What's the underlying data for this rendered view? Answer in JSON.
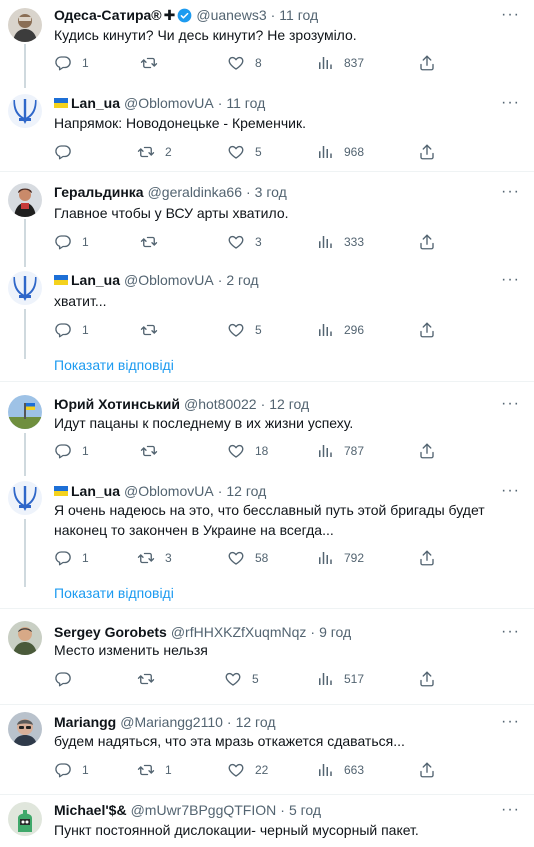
{
  "tweets": [
    {
      "name": "Одеса-Сатира®",
      "cross": "✚",
      "handle": "@uanews3",
      "time": "11 год",
      "text": "Кудись кинути? Чи десь кинути? Не зрозуміло.",
      "replies": "1",
      "retweets": "",
      "likes": "8",
      "views": "837"
    },
    {
      "name": "Lan_ua",
      "handle": "@OblomovUA",
      "time": "11 год",
      "text": "Напрямок: Новодонецьке - Кременчик.",
      "replies": "",
      "retweets": "2",
      "likes": "5",
      "views": "968"
    },
    {
      "name": "Геральдинка",
      "handle": "@geraldinka66",
      "time": "3 год",
      "text": "Главное чтобы у ВСУ арты хватило.",
      "replies": "1",
      "retweets": "",
      "likes": "3",
      "views": "333"
    },
    {
      "name": "Lan_ua",
      "handle": "@OblomovUA",
      "time": "2 год",
      "text": "хватит...",
      "replies": "1",
      "retweets": "",
      "likes": "5",
      "views": "296"
    },
    {
      "name": "Юрий Хотинський",
      "handle": "@hot80022",
      "time": "12 год",
      "text": "Идут пацаны к последнему в их жизни успеху.",
      "replies": "1",
      "retweets": "",
      "likes": "18",
      "views": "787"
    },
    {
      "name": "Lan_ua",
      "handle": "@OblomovUA",
      "time": "12 год",
      "text": "Я очень надеюсь на это, что бесславный путь этой бригады будет наконец то закончен в Украине на всегда...",
      "replies": "1",
      "retweets": "3",
      "likes": "58",
      "views": "792"
    },
    {
      "name": "Sergey Gorobets",
      "handle": "@rfHHXKZfXuqmNqz",
      "time": "9 год",
      "text": "Место изменить нельзя",
      "replies": "",
      "retweets": "",
      "likes": "5",
      "views": "517"
    },
    {
      "name": "Mariangg",
      "handle": "@Mariangg2110",
      "time": "12 год",
      "text": "будем надяться, что эта мразь откажется сдаваться...",
      "replies": "1",
      "retweets": "1",
      "likes": "22",
      "views": "663"
    },
    {
      "name": "Michael'$&",
      "handle": "@mUwr7BPggQTFION",
      "time": "5 год",
      "text": "Пункт постоянной дислокации- черный мусорный пакет."
    }
  ],
  "show_replies_label": "Показати відповіді",
  "more_glyph": "···",
  "colors": {
    "link": "#1d9bf0",
    "muted": "#536471",
    "text": "#0f1419",
    "verified": "#1d9bf0",
    "thread_line": "#cfd9de"
  }
}
